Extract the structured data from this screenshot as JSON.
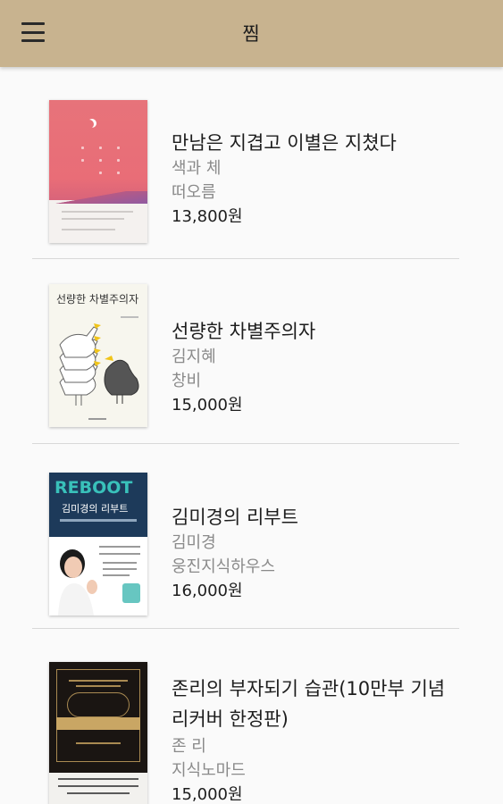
{
  "appbar": {
    "title": "찜",
    "menu_icon": "hamburger-menu-icon",
    "color": "#c8b38f"
  },
  "books": [
    {
      "title": "만남은 지겹고 이별은 지쳤다",
      "author": "색과 체",
      "publisher": "떠오름",
      "price": "13,800원"
    },
    {
      "title": "선량한 차별주의자",
      "author": "김지혜",
      "publisher": "창비",
      "price": "15,000원",
      "cover_title": "선량한 차별주의자"
    },
    {
      "title": "김미경의 리부트",
      "author": "김미경",
      "publisher": "웅진지식하우스",
      "price": "16,000원",
      "cover_brand": "REBOOT",
      "cover_title": "김미경의 리부트"
    },
    {
      "title": "존리의 부자되기 습관(10만부 기념 리커버 한정판)",
      "author": "존 리",
      "publisher": "지식노마드",
      "price": "15,000원"
    }
  ]
}
